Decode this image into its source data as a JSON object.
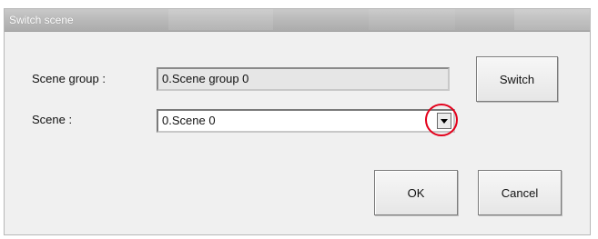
{
  "window": {
    "title": "Switch scene"
  },
  "form": {
    "scene_group_label": "Scene group :",
    "scene_group_value": "0.Scene group 0",
    "scene_label": "Scene :",
    "scene_value": "0.Scene 0"
  },
  "buttons": {
    "switch": "Switch",
    "ok": "OK",
    "cancel": "Cancel"
  },
  "icons": {
    "dropdown": "chevron-down-icon",
    "highlight_color": "#e3001b"
  }
}
